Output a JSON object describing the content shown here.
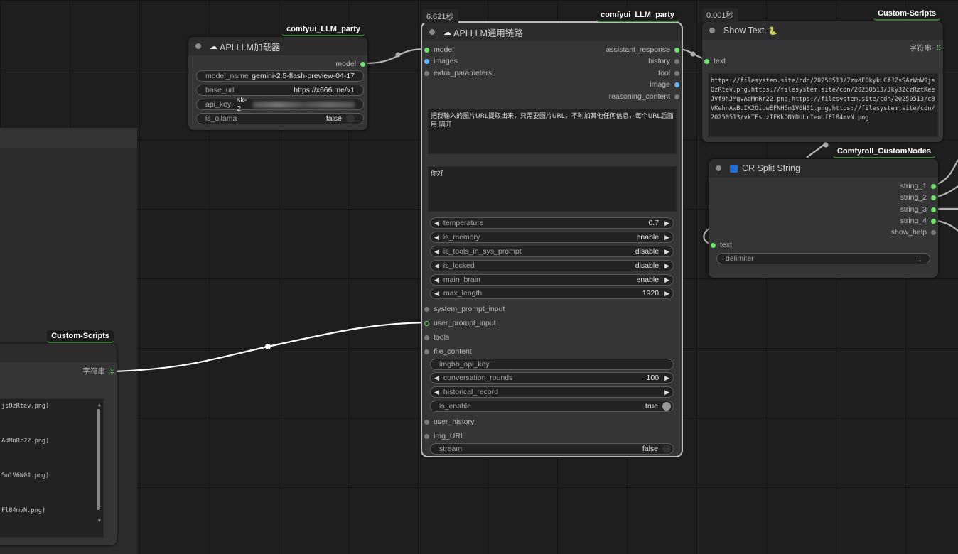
{
  "loader": {
    "badge": "comfyui_LLM_party",
    "title": "API LLM加载器",
    "output_model": "model",
    "widgets": [
      {
        "label": "model_name",
        "value": "gemini-2.5-flash-preview-04-17"
      },
      {
        "label": "base_url",
        "value": "https://x666.me/v1"
      },
      {
        "label": "api_key",
        "value": "sk-2"
      },
      {
        "label": "is_ollama",
        "value": "false"
      }
    ]
  },
  "chain": {
    "time": "6.621秒",
    "badge": "comfyui_LLM_party",
    "title": "API LLM通用链路",
    "inputs": [
      "model",
      "images",
      "extra_parameters"
    ],
    "outputs": [
      "assistant_response",
      "history",
      "tool",
      "image",
      "reasoning_content"
    ],
    "system_prompt": "把我输入的图片URL提取出来，只需要图片URL，不附加其他任何信息，每个URL后面用,隔开",
    "user_prompt": "你好",
    "numeric_widgets": [
      {
        "label": "temperature",
        "value": "0.7"
      },
      {
        "label": "is_memory",
        "value": "enable"
      },
      {
        "label": "is_tools_in_sys_prompt",
        "value": "disable"
      },
      {
        "label": "is_locked",
        "value": "disable"
      },
      {
        "label": "main_brain",
        "value": "enable"
      },
      {
        "label": "max_length",
        "value": "1920"
      }
    ],
    "inputs2": [
      "system_prompt_input",
      "user_prompt_input",
      "tools",
      "file_content"
    ],
    "imgbb_label": "imgbb_api_key",
    "conversation_rounds": {
      "label": "conversation_rounds",
      "value": "100"
    },
    "historical_record": {
      "label": "historical_record",
      "value": ""
    },
    "is_enable": {
      "label": "is_enable",
      "value": "true"
    },
    "inputs3": [
      "user_history",
      "img_URL"
    ],
    "stream": {
      "label": "stream",
      "value": "false"
    }
  },
  "showtext": {
    "time": "0.001秒",
    "badge": "Custom-Scripts",
    "title": "Show Text",
    "title_icon": "🐍",
    "input": "text",
    "output": "字符串",
    "content": "https://filesystem.site/cdn/20250513/7zudF0kykLCfJZsSAzWnW9jsQzRtev.png,https://filesystem.site/cdn/20250513/Jky32czRztKeeJVf9hJMgvAdMnRr22.png,https://filesystem.site/cdn/20250513/c8VKehnAwBUIK2OiuwEFNH5m1V6N01.png,https://filesystem.site/cdn/20250513/vkTEsUzTFKkDNYDULrIeuUfFl84mvN.png"
  },
  "split": {
    "badge": "Comfyroll_CustomNodes",
    "title": "CR Split String",
    "outputs": [
      "string_1",
      "string_2",
      "string_3",
      "string_4",
      "show_help"
    ],
    "input": "text",
    "delimiter_label": "delimiter",
    "delimiter_value": ","
  },
  "bottomleft": {
    "badge": "Custom-Scripts",
    "output": "字符串",
    "lines": [
      "jsQzRtev.png)",
      "AdMnRr22.png)",
      "5m1V6N01.png)",
      "Fl84mvN.png)"
    ]
  }
}
